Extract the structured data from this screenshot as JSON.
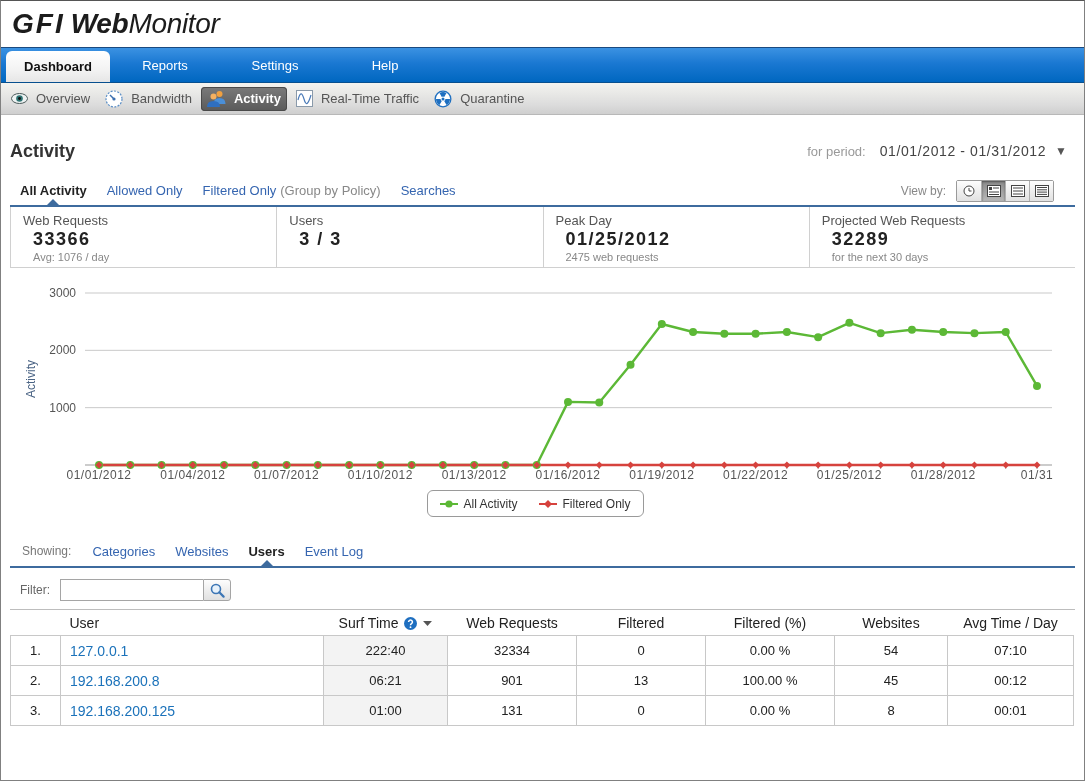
{
  "logo": {
    "brand": "GFI",
    "product": "**Web**Monitor"
  },
  "main_tabs": [
    {
      "label": "Dashboard",
      "selected": true
    },
    {
      "label": "Reports",
      "selected": false
    },
    {
      "label": "Settings",
      "selected": false
    },
    {
      "label": "Help",
      "selected": false
    }
  ],
  "sub_tabs": [
    {
      "label": "Overview",
      "selected": false
    },
    {
      "label": "Bandwidth",
      "selected": false
    },
    {
      "label": "Activity",
      "selected": true
    },
    {
      "label": "Real-Time Traffic",
      "selected": false
    },
    {
      "label": "Quarantine",
      "selected": false
    }
  ],
  "page": {
    "title": "Activity",
    "period_label": "for period:",
    "period": "01/01/2012 - 01/31/2012",
    "period_caret": "▼"
  },
  "filter_tabs": [
    {
      "label": "All Activity",
      "selected": true
    },
    {
      "label": "Allowed Only",
      "selected": false
    },
    {
      "label": "Filtered Only",
      "note": "(Group by Policy)",
      "selected": false
    },
    {
      "label": "Searches",
      "selected": false
    }
  ],
  "view_by": {
    "label": "View by:",
    "options": [
      {
        "selected": false
      },
      {
        "selected": true
      },
      {
        "selected": false
      },
      {
        "selected": false
      }
    ]
  },
  "stats": [
    {
      "label": "Web Requests",
      "value": "33366",
      "note": "Avg: 1076 / day"
    },
    {
      "label": "Users",
      "value": "3 / 3"
    },
    {
      "label": "Peak Day",
      "value": "01/25/2012",
      "note": "2475 web requests"
    },
    {
      "label": "Projected Web Requests",
      "value": "32289",
      "note": "for the next 30 days"
    }
  ],
  "chart": {
    "chart_data": {
      "type": "line",
      "ylabel": "Activity",
      "categories": [
        "01/01/2012",
        null,
        null,
        "01/04/2012",
        null,
        null,
        "01/07/2012",
        null,
        null,
        "01/10/2012",
        null,
        null,
        "01/13/2012",
        null,
        null,
        "01/16/2012",
        null,
        null,
        "01/19/2012",
        null,
        null,
        "01/22/2012",
        null,
        null,
        "01/25/2012",
        null,
        null,
        "01/28/2012",
        null,
        null,
        "01/31"
      ],
      "series": [
        {
          "name": "All Activity",
          "color": "#5cb836",
          "marker": "circle",
          "values": [
            0,
            0,
            0,
            0,
            0,
            0,
            0,
            0,
            0,
            0,
            0,
            0,
            0,
            0,
            0,
            1100,
            1090,
            1750,
            2460,
            2320,
            2290,
            2290,
            2320,
            2230,
            2480,
            2300,
            2360,
            2320,
            2300,
            2320,
            1380
          ]
        },
        {
          "name": "Filtered Only",
          "color": "#d6423d",
          "marker": "diamond",
          "values": [
            0,
            0,
            0,
            0,
            0,
            0,
            0,
            0,
            0,
            0,
            0,
            0,
            0,
            0,
            0,
            0,
            0,
            0,
            0,
            0,
            0,
            0,
            0,
            0,
            0,
            0,
            0,
            0,
            0,
            0,
            0
          ]
        }
      ],
      "ylim": [
        0,
        3000
      ],
      "yticks": [
        1000,
        2000,
        3000
      ],
      "legend": "bottom"
    }
  },
  "showing": {
    "label": "Showing:",
    "tabs": [
      {
        "label": "Categories",
        "selected": false
      },
      {
        "label": "Websites",
        "selected": false
      },
      {
        "label": "Users",
        "selected": true
      },
      {
        "label": "Event Log",
        "selected": false
      }
    ]
  },
  "filter": {
    "label": "Filter:"
  },
  "table": {
    "columns": [
      {
        "label": "User",
        "sorted": false,
        "help": false
      },
      {
        "label": "Surf Time",
        "sorted": true,
        "help": true
      },
      {
        "label": "Web Requests",
        "sorted": false,
        "help": false
      },
      {
        "label": "Filtered",
        "sorted": false,
        "help": false
      },
      {
        "label": "Filtered (%)",
        "sorted": false,
        "help": false
      },
      {
        "label": "Websites",
        "sorted": false,
        "help": false
      },
      {
        "label": "Avg Time / Day",
        "sorted": false,
        "help": false
      }
    ],
    "rows": [
      {
        "number": "1.",
        "cells": [
          "127.0.0.1",
          "222:40",
          "32334",
          "0",
          "0.00 %",
          "54",
          "07:10"
        ]
      },
      {
        "number": "2.",
        "cells": [
          "192.168.200.8",
          "06:21",
          "901",
          "13",
          "100.00 %",
          "45",
          "00:12"
        ]
      },
      {
        "number": "3.",
        "cells": [
          "192.168.200.125",
          "01:00",
          "131",
          "0",
          "0.00 %",
          "8",
          "00:01"
        ]
      }
    ]
  }
}
